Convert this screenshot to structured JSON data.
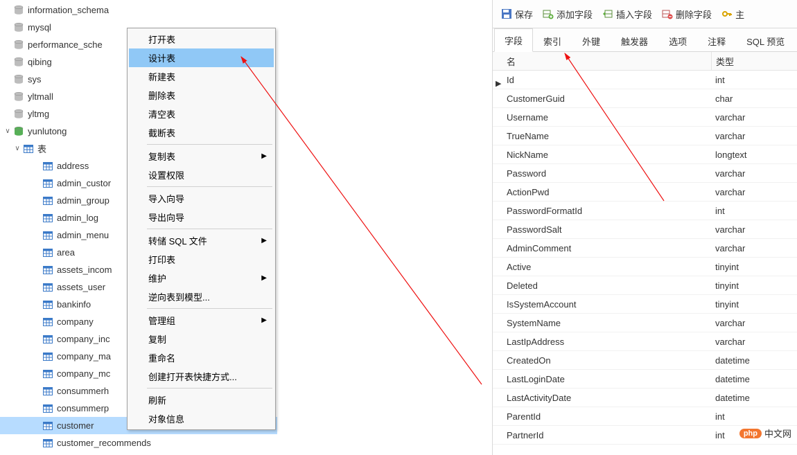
{
  "tree": {
    "databases": [
      {
        "label": "information_schema",
        "icon": "db-grey"
      },
      {
        "label": "mysql",
        "icon": "db-grey"
      },
      {
        "label": "performance_sche",
        "icon": "db-grey"
      },
      {
        "label": "qibing",
        "icon": "db-grey"
      },
      {
        "label": "sys",
        "icon": "db-grey"
      },
      {
        "label": "yltmall",
        "icon": "db-grey"
      },
      {
        "label": "yltmg",
        "icon": "db-grey"
      },
      {
        "label": "yunlutong",
        "icon": "db-green",
        "expanded": true
      }
    ],
    "tables_folder_label": "表",
    "tables": [
      "address",
      "admin_custor",
      "admin_group",
      "admin_log",
      "admin_menu",
      "area",
      "assets_incom",
      "assets_user",
      "bankinfo",
      "company",
      "company_inc",
      "company_ma",
      "company_mc",
      "consummerh",
      "consummerp",
      "customer",
      "customer_recommends"
    ],
    "selected_table": "customer"
  },
  "context_menu": {
    "items": [
      {
        "label": "打开表",
        "type": "item"
      },
      {
        "label": "设计表",
        "type": "item",
        "hover": true
      },
      {
        "label": "新建表",
        "type": "item"
      },
      {
        "label": "删除表",
        "type": "item"
      },
      {
        "label": "清空表",
        "type": "item"
      },
      {
        "label": "截断表",
        "type": "item"
      },
      {
        "type": "sep"
      },
      {
        "label": "复制表",
        "type": "item",
        "submenu": true
      },
      {
        "label": "设置权限",
        "type": "item"
      },
      {
        "type": "sep"
      },
      {
        "label": "导入向导",
        "type": "item"
      },
      {
        "label": "导出向导",
        "type": "item"
      },
      {
        "type": "sep"
      },
      {
        "label": "转储 SQL 文件",
        "type": "item",
        "submenu": true
      },
      {
        "label": "打印表",
        "type": "item"
      },
      {
        "label": "维护",
        "type": "item",
        "submenu": true
      },
      {
        "label": "逆向表到模型...",
        "type": "item"
      },
      {
        "type": "sep"
      },
      {
        "label": "管理组",
        "type": "item",
        "submenu": true
      },
      {
        "label": "复制",
        "type": "item"
      },
      {
        "label": "重命名",
        "type": "item"
      },
      {
        "label": "创建打开表快捷方式...",
        "type": "item"
      },
      {
        "type": "sep"
      },
      {
        "label": "刷新",
        "type": "item"
      },
      {
        "label": "对象信息",
        "type": "item"
      }
    ]
  },
  "toolbar": {
    "save": "保存",
    "add_field": "添加字段",
    "insert_field": "插入字段",
    "delete_field": "删除字段",
    "primary_key": "主"
  },
  "tabs": [
    {
      "label": "字段",
      "active": true
    },
    {
      "label": "索引"
    },
    {
      "label": "外键"
    },
    {
      "label": "触发器"
    },
    {
      "label": "选项"
    },
    {
      "label": "注释"
    },
    {
      "label": "SQL 预览"
    }
  ],
  "columns_header": {
    "name": "名",
    "type": "类型"
  },
  "fields": [
    {
      "name": "Id",
      "type": "int",
      "current": true
    },
    {
      "name": "CustomerGuid",
      "type": "char"
    },
    {
      "name": "Username",
      "type": "varchar"
    },
    {
      "name": "TrueName",
      "type": "varchar"
    },
    {
      "name": "NickName",
      "type": "longtext"
    },
    {
      "name": "Password",
      "type": "varchar"
    },
    {
      "name": "ActionPwd",
      "type": "varchar"
    },
    {
      "name": "PasswordFormatId",
      "type": "int"
    },
    {
      "name": "PasswordSalt",
      "type": "varchar"
    },
    {
      "name": "AdminComment",
      "type": "varchar"
    },
    {
      "name": "Active",
      "type": "tinyint"
    },
    {
      "name": "Deleted",
      "type": "tinyint"
    },
    {
      "name": "IsSystemAccount",
      "type": "tinyint"
    },
    {
      "name": "SystemName",
      "type": "varchar"
    },
    {
      "name": "LastIpAddress",
      "type": "varchar"
    },
    {
      "name": "CreatedOn",
      "type": "datetime"
    },
    {
      "name": "LastLoginDate",
      "type": "datetime"
    },
    {
      "name": "LastActivityDate",
      "type": "datetime"
    },
    {
      "name": "ParentId",
      "type": "int"
    },
    {
      "name": "PartnerId",
      "type": "int"
    }
  ],
  "watermark": {
    "badge": "php",
    "text": "中文网"
  }
}
